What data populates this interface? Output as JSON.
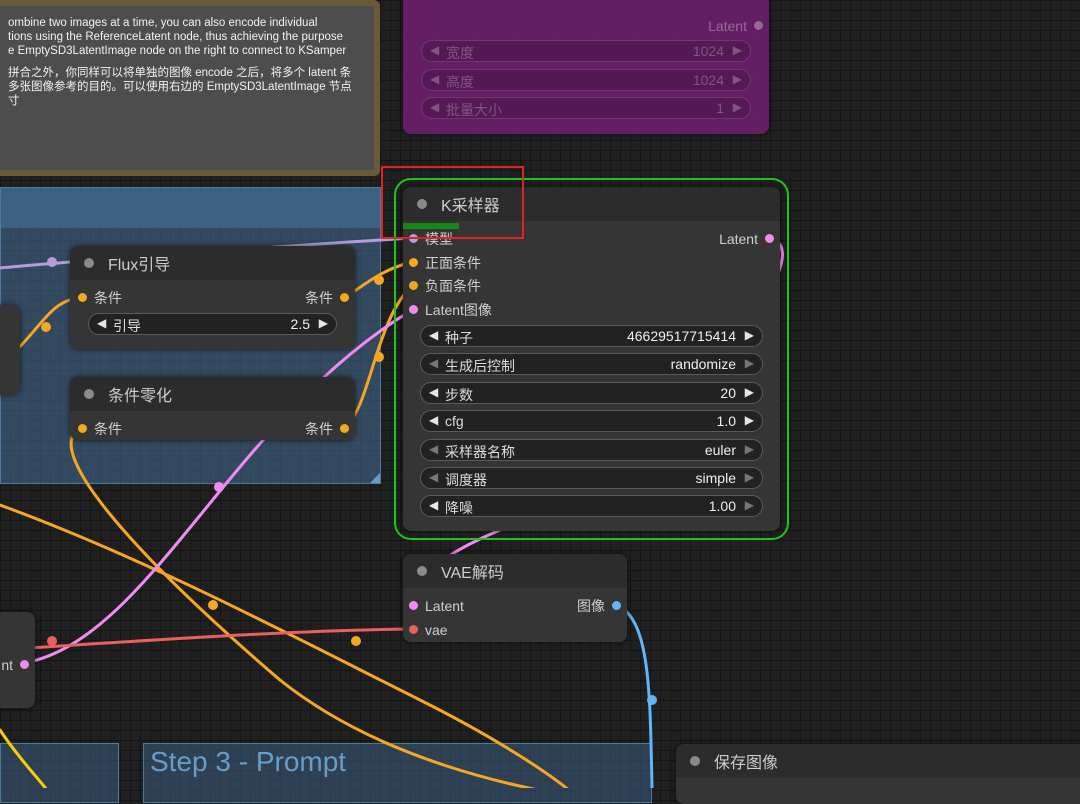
{
  "colors": {
    "model_wire": "#b39ddb",
    "conditioning_wire": "#f5a623",
    "latent_wire": "#f08cf0",
    "vae_wire": "#e86060",
    "image_wire": "#64b5f6",
    "clip_wire": "#f5d000",
    "selected_outline": "#1fc51f",
    "highlight": "#e02424"
  },
  "note": {
    "para_en": "ombine two images at a time, you can also encode individual\ntions using the ReferenceLatent node, thus achieving the purpose\ne EmptySD3LatentImage node on the right to connect to KSamper",
    "para_cn": "拼合之外，你同样可以将单独的图像 encode 之后，将多个 latent 条\n多张图像参考的目的。可以使用右边的 EmptySD3LatentImage 节点\n寸"
  },
  "latent_node": {
    "output_label": "Latent",
    "widgets": [
      {
        "label": "宽度",
        "value": "1024"
      },
      {
        "label": "高度",
        "value": "1024"
      },
      {
        "label": "批量大小",
        "value": "1"
      }
    ]
  },
  "ksampler": {
    "title": "K采样器",
    "inputs": [
      "模型",
      "正面条件",
      "负面条件",
      "Latent图像"
    ],
    "output": "Latent",
    "widgets": [
      {
        "label": "种子",
        "value": "46629517715414"
      },
      {
        "label": "生成后控制",
        "value": "randomize"
      },
      {
        "label": "步数",
        "value": "20"
      },
      {
        "label": "cfg",
        "value": "1.0"
      },
      {
        "label": "采样器名称",
        "value": "euler"
      },
      {
        "label": "调度器",
        "value": "simple"
      },
      {
        "label": "降噪",
        "value": "1.00"
      }
    ]
  },
  "flux_guidance": {
    "title": "Flux引导",
    "input": "条件",
    "output": "条件",
    "widget": {
      "label": "引导",
      "value": "2.5"
    }
  },
  "cond_zero": {
    "title": "条件零化",
    "input": "条件",
    "output": "条件"
  },
  "vae_decode": {
    "title": "VAE解码",
    "inputs": [
      "Latent",
      "vae"
    ],
    "output": "图像"
  },
  "left_partial": {
    "output": "nt"
  },
  "group_prompt": {
    "title": "Step 3 - Prompt"
  },
  "save_image": {
    "title": "保存图像"
  }
}
